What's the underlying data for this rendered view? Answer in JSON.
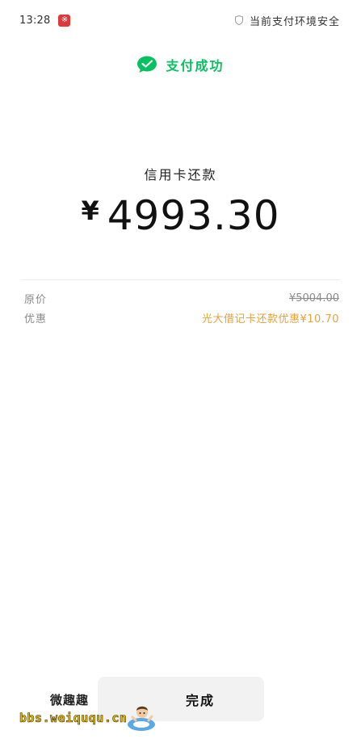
{
  "status_bar": {
    "time": "13:28",
    "app_badge_glyph": "※",
    "safety_text": "当前支付环境安全"
  },
  "header": {
    "title": "支付成功",
    "icon": "wechat-pay-icon",
    "accent_color": "#07c160"
  },
  "payment": {
    "merchant": "信用卡还款",
    "currency_symbol": "¥",
    "amount": "4993.30"
  },
  "details": [
    {
      "label": "原价",
      "value": "¥5004.00"
    },
    {
      "label": "优惠",
      "value": "光大借记卡还款优惠¥10.70",
      "color": "#e6a23c"
    }
  ],
  "actions": {
    "done_label": "完成"
  },
  "watermark": {
    "title": "微趣趣",
    "url": "bbs.weiququ.cn"
  }
}
